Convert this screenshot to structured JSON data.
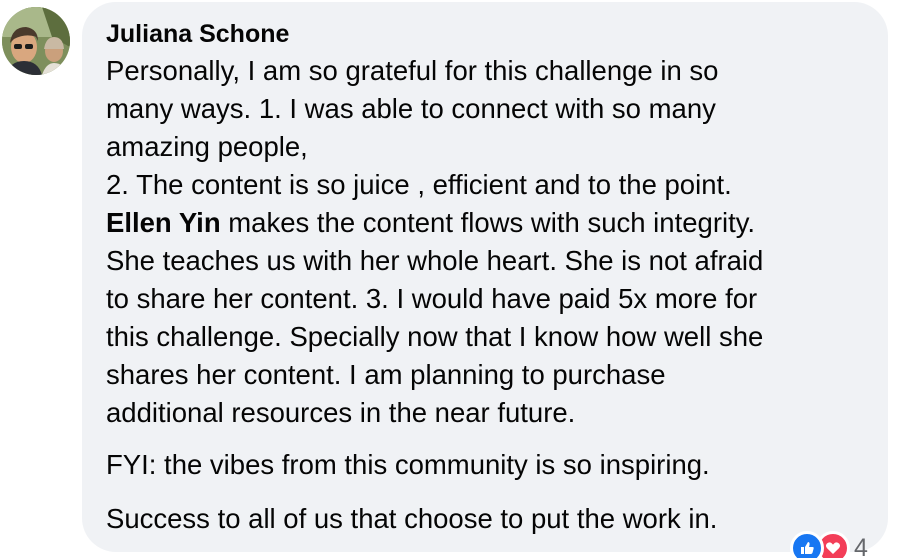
{
  "comment": {
    "author": "Juliana Schone",
    "paragraph1": {
      "line1": "Personally, I am so grateful for this challenge in so",
      "line2": "many ways. 1. I was able to connect with so many",
      "line3": "amazing people,",
      "line4": "2. The content is so juice , efficient and to the point.",
      "line5_mention": "Ellen Yin",
      "line5_rest": " makes the content flows with such integrity.",
      "line6": "She teaches us with her whole heart. She is not afraid",
      "line7": "to share her content. 3. I would have paid 5x more for",
      "line8": "this challenge. Specially now that I know how well she",
      "line9": "shares her content. I am planning to purchase",
      "line10": "additional resources in the near future."
    },
    "paragraph2": "FYI: the vibes from this community is so inspiring.",
    "paragraph3": "Success to all of us that choose to put the work in.",
    "reactions": {
      "icons": [
        "like-icon",
        "love-icon"
      ],
      "count": "4",
      "like_color": "#1877f2",
      "love_color": "#f33e58"
    }
  },
  "colors": {
    "bubble_background": "#f0f2f5",
    "text": "#050505",
    "secondary_text": "#65676b"
  }
}
